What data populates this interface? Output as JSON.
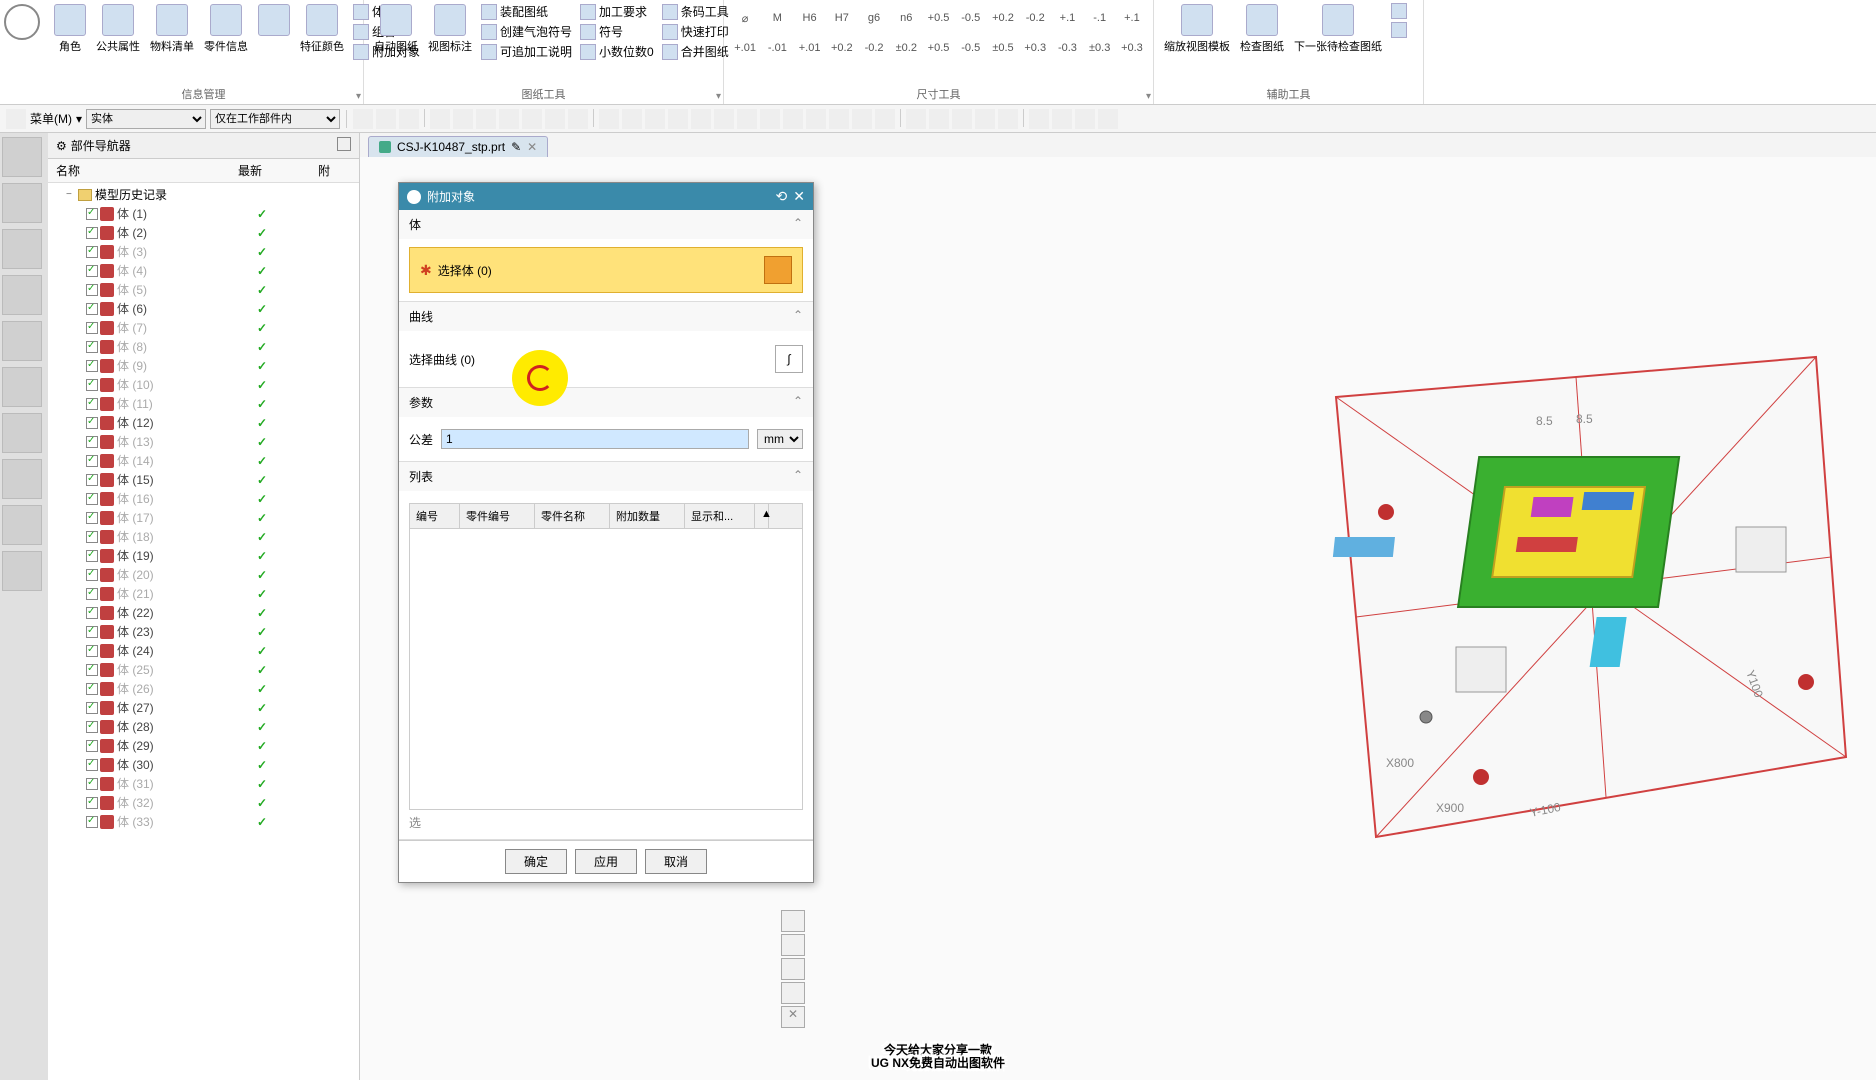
{
  "ribbon": {
    "groups": {
      "info": {
        "label": "信息管理",
        "btns": [
          "角色",
          "公共属性",
          "物料清单",
          "零件信息",
          "",
          "特征颜色",
          "附加对象"
        ],
        "small": [
          "体着色",
          "组合"
        ]
      },
      "draw": {
        "label": "图纸工具",
        "btns": [
          "自动图纸",
          "视图标注"
        ],
        "small": [
          "装配图纸",
          "创建气泡符号",
          "可追加工说明",
          "加工要求",
          "符号",
          "小数位数0",
          "快速打印",
          "合并图纸",
          "条码工具"
        ]
      },
      "dim": {
        "label": "尺寸工具"
      },
      "aux": {
        "label": "辅助工具",
        "btns": [
          "缩放视图模板",
          "检查图纸",
          "下一张待检查图纸"
        ]
      }
    },
    "dims_row1": [
      "⌀",
      "M",
      "H6",
      "H7",
      "g6",
      "n6",
      "+0.5",
      "-0.5",
      "+0.2",
      "-0.2",
      "+.1",
      "-.1",
      "+.1"
    ],
    "dims_row2": [
      "+.01",
      "-.01",
      "+.01",
      "+0.2",
      "-0.2",
      "±0.2",
      "+0.5",
      "-0.5",
      "±0.5",
      "+0.3",
      "-0.3",
      "±0.3",
      "+0.3"
    ]
  },
  "toolbar2": {
    "menu": "菜单(M)",
    "sel1": "实体",
    "sel2": "仅在工作部件内"
  },
  "navigator": {
    "title": "部件导航器",
    "cols": [
      "名称",
      "最新",
      "附"
    ],
    "root": "模型历史记录",
    "items": [
      {
        "n": "体 (1)",
        "a": true
      },
      {
        "n": "体 (2)",
        "a": true
      },
      {
        "n": "体 (3)",
        "a": false
      },
      {
        "n": "体 (4)",
        "a": false
      },
      {
        "n": "体 (5)",
        "a": false
      },
      {
        "n": "体 (6)",
        "a": true
      },
      {
        "n": "体 (7)",
        "a": false
      },
      {
        "n": "体 (8)",
        "a": false
      },
      {
        "n": "体 (9)",
        "a": false
      },
      {
        "n": "体 (10)",
        "a": false
      },
      {
        "n": "体 (11)",
        "a": false
      },
      {
        "n": "体 (12)",
        "a": true
      },
      {
        "n": "体 (13)",
        "a": false
      },
      {
        "n": "体 (14)",
        "a": false
      },
      {
        "n": "体 (15)",
        "a": true
      },
      {
        "n": "体 (16)",
        "a": false
      },
      {
        "n": "体 (17)",
        "a": false
      },
      {
        "n": "体 (18)",
        "a": false
      },
      {
        "n": "体 (19)",
        "a": true
      },
      {
        "n": "体 (20)",
        "a": false
      },
      {
        "n": "体 (21)",
        "a": false
      },
      {
        "n": "体 (22)",
        "a": true
      },
      {
        "n": "体 (23)",
        "a": true
      },
      {
        "n": "体 (24)",
        "a": true
      },
      {
        "n": "体 (25)",
        "a": false
      },
      {
        "n": "体 (26)",
        "a": false
      },
      {
        "n": "体 (27)",
        "a": true
      },
      {
        "n": "体 (28)",
        "a": true
      },
      {
        "n": "体 (29)",
        "a": true
      },
      {
        "n": "体 (30)",
        "a": true
      },
      {
        "n": "体 (31)",
        "a": false
      },
      {
        "n": "体 (32)",
        "a": false
      },
      {
        "n": "体 (33)",
        "a": false
      }
    ]
  },
  "tab": {
    "name": "CSJ-K10487_stp.prt"
  },
  "dialog": {
    "title": "附加对象",
    "sec_body": "体",
    "select_body": "选择体 (0)",
    "sec_curve": "曲线",
    "select_curve": "选择曲线 (0)",
    "sec_param": "参数",
    "param_label": "公差",
    "param_value": "1",
    "param_unit": "mm",
    "sec_list": "列表",
    "list_cols": [
      "编号",
      "零件编号",
      "零件名称",
      "附加数量",
      "显示和..."
    ],
    "sel_label": "选",
    "ok": "确定",
    "apply": "应用",
    "cancel": "取消"
  },
  "subtitle": {
    "l1": "今天给大家分享一款",
    "l2": "UG  NX免费自动出图软件"
  }
}
